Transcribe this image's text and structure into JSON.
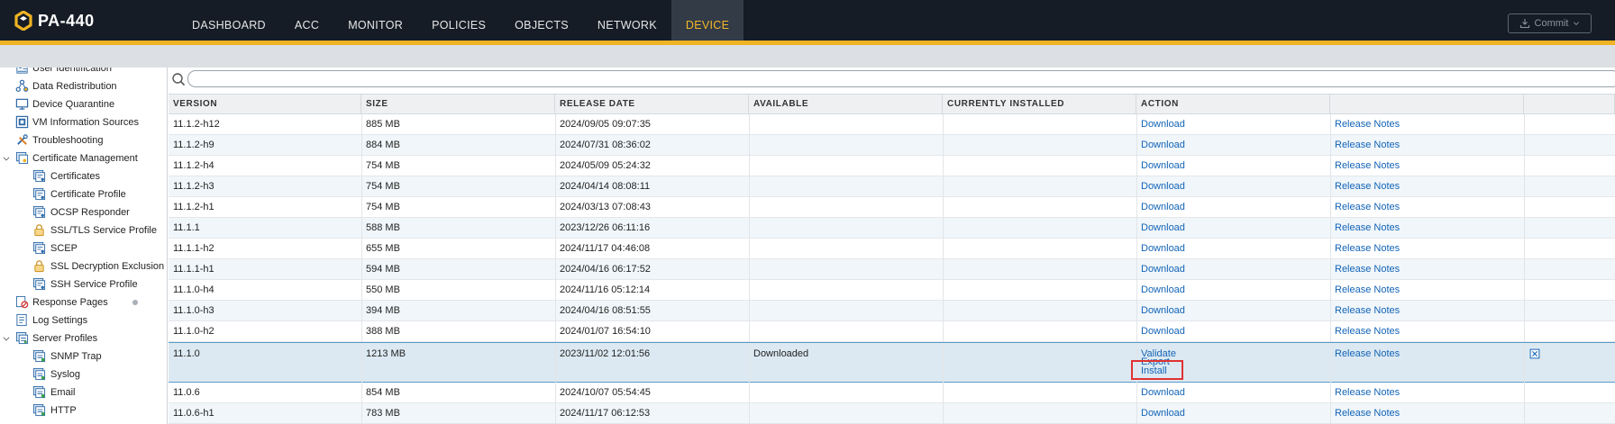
{
  "app": {
    "logo_text": "PA-440",
    "commit_label": "Commit",
    "brand_color": "#f0b323",
    "link_color": "#1364b7"
  },
  "nav": [
    {
      "label": "DASHBOARD",
      "active": false
    },
    {
      "label": "ACC",
      "active": false
    },
    {
      "label": "MONITOR",
      "active": false
    },
    {
      "label": "POLICIES",
      "active": false
    },
    {
      "label": "OBJECTS",
      "active": false
    },
    {
      "label": "NETWORK",
      "active": false
    },
    {
      "label": "DEVICE",
      "active": true
    }
  ],
  "sidebar": {
    "items": [
      {
        "label": "User Identification",
        "icon": "user-id-icon",
        "level": 0,
        "chevron": "",
        "dot": false
      },
      {
        "label": "Data Redistribution",
        "icon": "redistribution-icon",
        "level": 0,
        "chevron": "",
        "dot": false
      },
      {
        "label": "Device Quarantine",
        "icon": "quarantine-icon",
        "level": 0,
        "chevron": "",
        "dot": false
      },
      {
        "label": "VM Information Sources",
        "icon": "vm-icon",
        "level": 0,
        "chevron": "",
        "dot": false
      },
      {
        "label": "Troubleshooting",
        "icon": "tools-icon",
        "level": 0,
        "chevron": "",
        "dot": false
      },
      {
        "label": "Certificate Management",
        "icon": "certificate-folder-icon",
        "level": 0,
        "chevron": "expanded",
        "dot": false
      },
      {
        "label": "Certificates",
        "icon": "certificate-icon",
        "level": 1,
        "chevron": "",
        "dot": false
      },
      {
        "label": "Certificate Profile",
        "icon": "certificate-icon",
        "level": 1,
        "chevron": "",
        "dot": false
      },
      {
        "label": "OCSP Responder",
        "icon": "certificate-icon",
        "level": 1,
        "chevron": "",
        "dot": false
      },
      {
        "label": "SSL/TLS Service Profile",
        "icon": "lock-icon",
        "level": 1,
        "chevron": "",
        "dot": false
      },
      {
        "label": "SCEP",
        "icon": "certificate-icon",
        "level": 1,
        "chevron": "",
        "dot": false
      },
      {
        "label": "SSL Decryption Exclusion",
        "icon": "lock-icon",
        "level": 1,
        "chevron": "",
        "dot": false
      },
      {
        "label": "SSH Service Profile",
        "icon": "certificate-icon",
        "level": 1,
        "chevron": "",
        "dot": false
      },
      {
        "label": "Response Pages",
        "icon": "response-pages-icon",
        "level": 0,
        "chevron": "",
        "dot": true
      },
      {
        "label": "Log Settings",
        "icon": "log-settings-icon",
        "level": 0,
        "chevron": "",
        "dot": false
      },
      {
        "label": "Server Profiles",
        "icon": "server-folder-icon",
        "level": 0,
        "chevron": "expanded",
        "dot": false
      },
      {
        "label": "SNMP Trap",
        "icon": "server-profile-icon",
        "level": 1,
        "chevron": "",
        "dot": false
      },
      {
        "label": "Syslog",
        "icon": "server-profile-icon",
        "level": 1,
        "chevron": "",
        "dot": false
      },
      {
        "label": "Email",
        "icon": "server-profile-icon",
        "level": 1,
        "chevron": "",
        "dot": false
      },
      {
        "label": "HTTP",
        "icon": "server-profile-icon",
        "level": 1,
        "chevron": "",
        "dot": false
      }
    ]
  },
  "search": {
    "placeholder": "",
    "value": ""
  },
  "table": {
    "columns": [
      "VERSION",
      "SIZE",
      "RELEASE DATE",
      "AVAILABLE",
      "CURRENTLY INSTALLED",
      "ACTION",
      "",
      ""
    ],
    "rows": [
      {
        "version": "11.1.2-h12",
        "size": "885 MB",
        "release_date": "2024/09/05 09:07:35",
        "available": "",
        "currently_installed": "",
        "actions": [
          "Download"
        ],
        "notes": "Release Notes",
        "delete": false
      },
      {
        "version": "11.1.2-h9",
        "size": "884 MB",
        "release_date": "2024/07/31 08:36:02",
        "available": "",
        "currently_installed": "",
        "actions": [
          "Download"
        ],
        "notes": "Release Notes",
        "delete": false
      },
      {
        "version": "11.1.2-h4",
        "size": "754 MB",
        "release_date": "2024/05/09 05:24:32",
        "available": "",
        "currently_installed": "",
        "actions": [
          "Download"
        ],
        "notes": "Release Notes",
        "delete": false
      },
      {
        "version": "11.1.2-h3",
        "size": "754 MB",
        "release_date": "2024/04/14 08:08:11",
        "available": "",
        "currently_installed": "",
        "actions": [
          "Download"
        ],
        "notes": "Release Notes",
        "delete": false
      },
      {
        "version": "11.1.2-h1",
        "size": "754 MB",
        "release_date": "2024/03/13 07:08:43",
        "available": "",
        "currently_installed": "",
        "actions": [
          "Download"
        ],
        "notes": "Release Notes",
        "delete": false
      },
      {
        "version": "11.1.1",
        "size": "588 MB",
        "release_date": "2023/12/26 06:11:16",
        "available": "",
        "currently_installed": "",
        "actions": [
          "Download"
        ],
        "notes": "Release Notes",
        "delete": false
      },
      {
        "version": "11.1.1-h2",
        "size": "655 MB",
        "release_date": "2024/11/17 04:46:08",
        "available": "",
        "currently_installed": "",
        "actions": [
          "Download"
        ],
        "notes": "Release Notes",
        "delete": false
      },
      {
        "version": "11.1.1-h1",
        "size": "594 MB",
        "release_date": "2024/04/16 06:17:52",
        "available": "",
        "currently_installed": "",
        "actions": [
          "Download"
        ],
        "notes": "Release Notes",
        "delete": false
      },
      {
        "version": "11.1.0-h4",
        "size": "550 MB",
        "release_date": "2024/11/16 05:12:14",
        "available": "",
        "currently_installed": "",
        "actions": [
          "Download"
        ],
        "notes": "Release Notes",
        "delete": false
      },
      {
        "version": "11.1.0-h3",
        "size": "394 MB",
        "release_date": "2024/04/16 08:51:55",
        "available": "",
        "currently_installed": "",
        "actions": [
          "Download"
        ],
        "notes": "Release Notes",
        "delete": false
      },
      {
        "version": "11.1.0-h2",
        "size": "388 MB",
        "release_date": "2024/01/07 16:54:10",
        "available": "",
        "currently_installed": "",
        "actions": [
          "Download"
        ],
        "notes": "Release Notes",
        "delete": false
      },
      {
        "version": "11.1.0",
        "size": "1213 MB",
        "release_date": "2023/11/02 12:01:56",
        "available": "Downloaded",
        "currently_installed": "",
        "actions": [
          "Validate",
          "Export",
          "Install"
        ],
        "notes": "Release Notes",
        "delete": true,
        "selected": true,
        "highlighted_action": "Install"
      },
      {
        "version": "11.0.6",
        "size": "854 MB",
        "release_date": "2024/10/07 05:54:45",
        "available": "",
        "currently_installed": "",
        "actions": [
          "Download"
        ],
        "notes": "Release Notes",
        "delete": false
      },
      {
        "version": "11.0.6-h1",
        "size": "783 MB",
        "release_date": "2024/11/17 06:12:53",
        "available": "",
        "currently_installed": "",
        "actions": [
          "Download"
        ],
        "notes": "Release Notes",
        "delete": false
      }
    ]
  }
}
